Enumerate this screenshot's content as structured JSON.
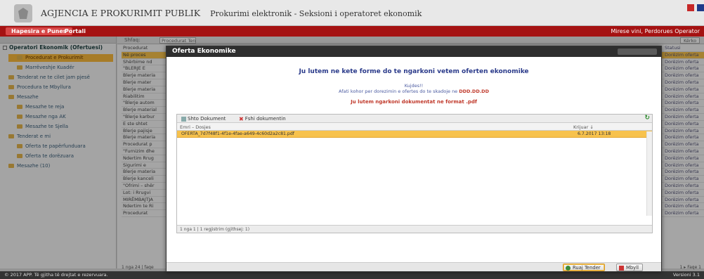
{
  "header": {
    "title": "AGJENCIA E PROKURIMIT PUBLIK",
    "subtitle": "Prokurimi elektronik - Seksioni i operatoret ekonomik"
  },
  "nav": {
    "tabs": [
      "Hapesira e Punes",
      "Portali"
    ],
    "welcome": "Mirese vini, Perdorues Operator"
  },
  "sidebar": {
    "root": "Operatori Ekonomik (Ofertuesi)",
    "items": [
      {
        "label": "Procedurat e Prokurimit",
        "level": 1,
        "selected": true
      },
      {
        "label": "Marrëveshje Kuadër",
        "level": 2
      },
      {
        "label": "Tenderat ne te cilet jam pjesë",
        "level": 1
      },
      {
        "label": "Procedura te Mbyllura",
        "level": 1
      },
      {
        "label": "Mesazhe",
        "level": 1
      },
      {
        "label": "Mesazhe te reja",
        "level": 2
      },
      {
        "label": "Mesazhe nga AK",
        "level": 2
      },
      {
        "label": "Mesazhe te Sjella",
        "level": 2
      },
      {
        "label": "Tenderat e mi",
        "level": 1
      },
      {
        "label": "Oferta te papërfunduara",
        "level": 2
      },
      {
        "label": "Oferta te dorëzuara",
        "level": 2
      },
      {
        "label": "Mesazhe (10)",
        "level": 1
      }
    ]
  },
  "main_list": {
    "toolbar_label": "Shfaq:",
    "filter_value": "Procedurat Tender",
    "search_label": "Kërko",
    "left_rows": [
      "Procedurat",
      "Në proces",
      "Shërbime nd",
      "\"BLERJE E",
      "Blerje materia",
      "Blerje mater",
      "Blerje materia",
      "Riabilitim",
      "\"Blerje autom",
      "Blerje material",
      "\"Blerje karbur",
      "E ste shtet",
      "Blerje pajisje",
      "Blerje materia",
      "Procedurat p",
      "\"Furnizim dhe",
      "Ndertim Rrug",
      "Sigurimi e",
      "Blerje materia",
      "Blerje kanceli",
      "\"Ofrimi – shër",
      "Lot: i Rrugvi",
      "MIRËMBAJTJA",
      "Ndertim te Ri",
      "Procedurat"
    ],
    "right_rows": [
      "Statusi",
      "Dorëzim oferta",
      "Dorëzim oferta",
      "Dorëzim oferta",
      "Dorëzim oferta",
      "Dorëzim oferta",
      "Dorëzim oferta",
      "Dorëzim oferta",
      "Dorëzim oferta",
      "Dorëzim oferta",
      "Dorëzim oferta",
      "Dorëzim oferta",
      "Dorëzim oferta",
      "Dorëzim oferta",
      "Dorëzim oferta",
      "Dorëzim oferta",
      "Dorëzim oferta",
      "Dorëzim oferta",
      "Dorëzim oferta",
      "Dorëzim oferta",
      "Dorëzim oferta",
      "Dorëzim oferta",
      "Dorëzim oferta",
      "Dorëzim oferta",
      "Dorëzim oferta"
    ],
    "pager_left": "1 nga 24 | faqe",
    "pager_right": "1 ▸ Faqe 1"
  },
  "modal": {
    "title": "Oferta Ekonomike",
    "heading": "Ju lutem ne kete forme do te ngarkoni vetem oferten ekonomike",
    "note_line1": "Kujdes!!",
    "note_line2_prefix": "Afati kohor per dorezimin e ofertes do te skadoje ne",
    "note_line2_date": "DDD.DD.DD",
    "warning": "Ju lutem ngarkoni dokumentat ne format .pdf",
    "toolbar_add": "Shto Dokument",
    "toolbar_delete": "Fshi dokumentin",
    "col_name": "Emri – Dosjes",
    "col_date": "Krijuar ↓",
    "rows": [
      {
        "name": "OFERTA_7d7f48f1-4f1e-4fae-a649-4c60d2a2c81.pdf",
        "date": "6.7.2017 13:18"
      }
    ],
    "grid_footer": "1 nga 1 | 1 regjistrim (gjithsej: 1)",
    "btn_save": "Ruaj Tender",
    "btn_close": "Mbyll"
  },
  "footer": {
    "left": "© 2017 APP. Të gjitha të drejtat e rezervuara.",
    "right": "Versioni 3.1"
  }
}
